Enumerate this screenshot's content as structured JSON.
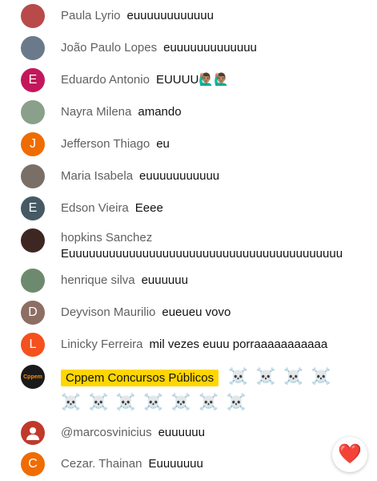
{
  "messages": [
    {
      "author": "Paula Lyrio",
      "text": "euuuuuuuuuuuu",
      "avatar_color": "#b94a4a",
      "avatar_text": ""
    },
    {
      "author": "João Paulo Lopes",
      "text": "euuuuuuuuuuuuu",
      "avatar_color": "#6b7a8a",
      "avatar_text": ""
    },
    {
      "author": "Eduardo Antonio",
      "text": "EUUUU🙋🏽‍♂️🙋🏽‍♂️",
      "avatar_color": "#c2185b",
      "avatar_text": "E"
    },
    {
      "author": "Nayra Milena",
      "text": "amando",
      "avatar_color": "#8aa08a",
      "avatar_text": ""
    },
    {
      "author": "Jefferson Thiago",
      "text": "eu",
      "avatar_color": "#ef6c00",
      "avatar_text": "J"
    },
    {
      "author": "Maria Isabela",
      "text": "euuuuuuuuuuu",
      "avatar_color": "#7a6f66",
      "avatar_text": ""
    },
    {
      "author": "Edson Vieira",
      "text": "Eeee",
      "avatar_color": "#455a64",
      "avatar_text": "E"
    },
    {
      "author": "hopkins Sanchez",
      "text": "Euuuuuuuuuuuuuuuuuuuuuuuuuuuuuuuuuuuuuuuuu",
      "avatar_color": "#3e2723",
      "avatar_text": ""
    },
    {
      "author": "henrique silva",
      "text": "euuuuuu",
      "avatar_color": "#6e8a6e",
      "avatar_text": ""
    },
    {
      "author": "Deyvison Maurilio",
      "text": "eueueu vovo",
      "avatar_color": "#8d6e63",
      "avatar_text": "D"
    },
    {
      "author": "Linicky Ferreira",
      "text": "mil vezes euuu porraaaaaaaaaaa",
      "avatar_color": "#f4511e",
      "avatar_text": "L"
    },
    {
      "author": "Cppem Concursos Públicos",
      "text_line1": "☠️ ☠️ ☠️ ☠️",
      "text_line2": "☠️ ☠️ ☠️ ☠️ ☠️ ☠️ ☠️",
      "avatar_color": "#1a1a1a",
      "avatar_text": "Cppem"
    },
    {
      "author": "@marcosvinicius",
      "text": "euuuuuu",
      "avatar_color": "#c0392b",
      "avatar_text": ""
    },
    {
      "author": "Cezar. Thainan",
      "text": "Euuuuuuu",
      "avatar_color": "#ef6c00",
      "avatar_text": "C"
    }
  ],
  "heart_icon": "❤️"
}
